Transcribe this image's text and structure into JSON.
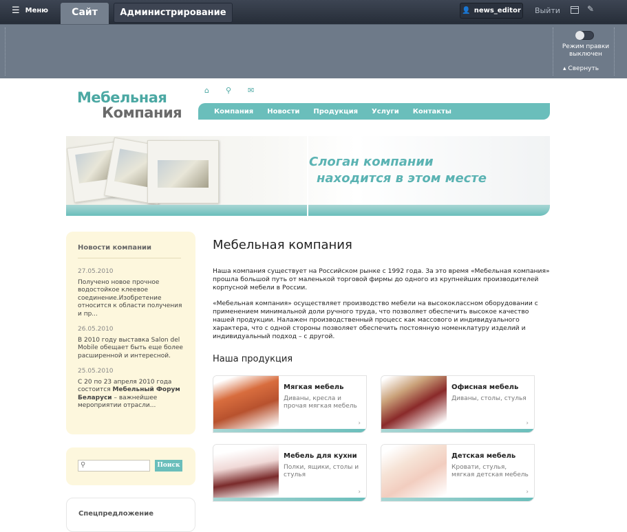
{
  "admin": {
    "menu_label": "Меню",
    "tab_site": "Сайт",
    "tab_admin": "Администрирование",
    "user": "news_editor",
    "logout": "Выйти",
    "edit_mode_line1": "Режим правки",
    "edit_mode_line2": "выключен",
    "collapse": "Свернуть"
  },
  "header": {
    "logo_line1": "Мебельная",
    "logo_line2": "Компания",
    "nav": [
      "Компания",
      "Новости",
      "Продукция",
      "Услуги",
      "Контакты"
    ]
  },
  "banner": {
    "slogan_line1": "Слоган компании",
    "slogan_line2": "находится в этом месте"
  },
  "sidebar": {
    "news_title": "Новости компании",
    "news": [
      {
        "date": "27.05.2010",
        "text": "Получено новое прочное водостойкое клеевое соединение.Изобретение относится к области получения и пр..."
      },
      {
        "date": "26.05.2010",
        "text": "В 2010 году выставка Salon del Mobile обещает быть еще более расширенной и интересной."
      },
      {
        "date": "25.05.2010",
        "text_before": "С 20 по 23 апреля 2010 года состоится ",
        "text_bold": "Мебельный Форум Беларуси",
        "text_after": " – важнейшее мероприятии отрасли..."
      }
    ],
    "search_button": "Поиск",
    "specials_title": "Спецпредложение"
  },
  "main": {
    "title": "Мебельная компания",
    "para1": "Наша компания существует на Российском рынке с 1992 года. За это время «Мебельная компания» прошла большой путь от маленькой торговой фирмы до одного из крупнейших производителей корпусной мебели в России.",
    "para2": "«Мебельная компания» осуществляет производство мебели на высококлассном оборудовании с применением минимальной доли ручного труда, что позволяет обеспечить высокое качество нашей продукции. Налажен производственный процесс как массового и индивидуального характера, что с одной стороны позволяет обеспечить постоянную номенклатуру изделий и индивидуальный подход – с другой.",
    "products_title": "Наша продукция",
    "products": [
      {
        "title": "Мягкая мебель",
        "desc": "Диваны, кресла и прочая мягкая мебель"
      },
      {
        "title": "Офисная мебель",
        "desc": "Диваны, столы, стулья"
      },
      {
        "title": "Мебель для кухни",
        "desc": "Полки, ящики, столы и стулья"
      },
      {
        "title": "Детская мебель",
        "desc": "Кровати, стулья, мягкая детская мебель"
      }
    ]
  },
  "colors": {
    "accent": "#6abebb",
    "logo_teal": "#4ba8a3",
    "sidebar_bg": "#fdf7dd",
    "admin_bg": "#6e7a89"
  }
}
